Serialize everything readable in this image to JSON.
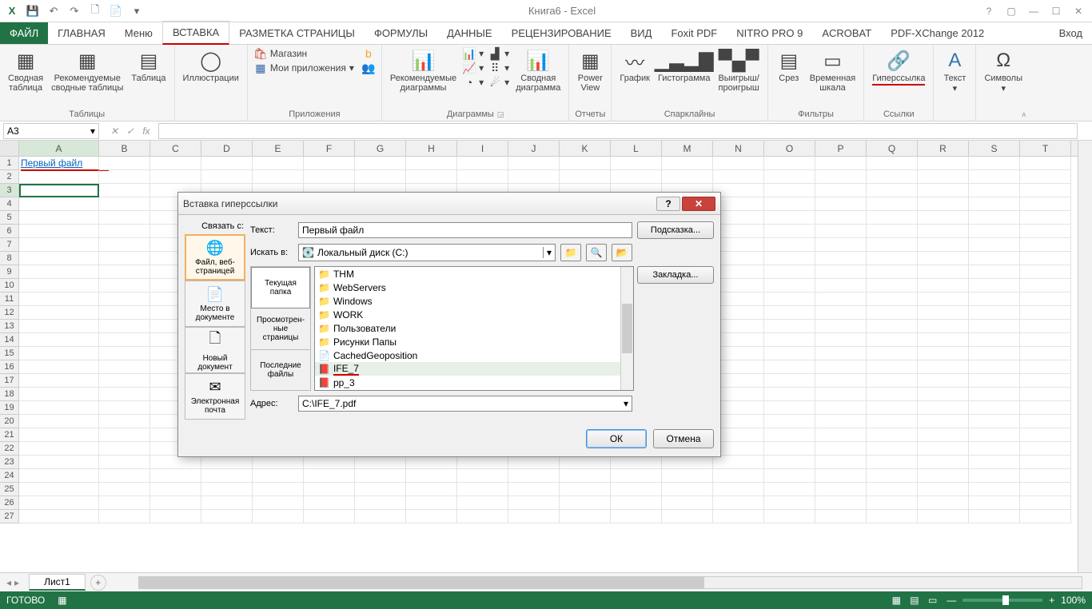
{
  "app": {
    "title": "Книга6 - Excel"
  },
  "qat": {
    "save": "💾",
    "undo": "↶",
    "redo": "↷",
    "new": "🗋",
    "open": "📄"
  },
  "tabs": {
    "file": "ФАЙЛ",
    "home": "ГЛАВНАЯ",
    "menu": "Меню",
    "insert": "ВСТАВКА",
    "pagelayout": "РАЗМЕТКА СТРАНИЦЫ",
    "formulas": "ФОРМУЛЫ",
    "data": "ДАННЫЕ",
    "review": "РЕЦЕНЗИРОВАНИЕ",
    "view": "ВИД",
    "foxit": "Foxit PDF",
    "nitro": "NITRO PRO 9",
    "acrobat": "ACROBAT",
    "pdfx": "PDF-XChange 2012",
    "login": "Вход"
  },
  "ribbon": {
    "tables": {
      "pivot": "Сводная\nтаблица",
      "recpivot": "Рекомендуемые\nсводные таблицы",
      "table": "Таблица",
      "group": "Таблицы"
    },
    "illus": {
      "label": "Иллюстрации"
    },
    "apps": {
      "store": "Магазин",
      "myapps": "Мои приложения",
      "group": "Приложения"
    },
    "charts": {
      "rec": "Рекомендуемые\nдиаграммы",
      "pivotchart": "Сводная\nдиаграмма",
      "group": "Диаграммы"
    },
    "reports": {
      "powerview": "Power\nView",
      "group": "Отчеты"
    },
    "sparks": {
      "line": "График",
      "col": "Гистограмма",
      "winloss": "Выигрыш/\nпроигрыш",
      "group": "Спарклайны"
    },
    "filters": {
      "slicer": "Срез",
      "timeline": "Временная\nшкала",
      "group": "Фильтры"
    },
    "links": {
      "hyper": "Гиперссылка",
      "group": "Ссылки"
    },
    "text": {
      "label": "Текст"
    },
    "symbols": {
      "label": "Символы"
    }
  },
  "namebox": "A3",
  "sheet": {
    "cols": [
      "A",
      "B",
      "C",
      "D",
      "E",
      "F",
      "G",
      "H",
      "I",
      "J",
      "K",
      "L",
      "M",
      "N",
      "O",
      "P",
      "Q",
      "R",
      "S",
      "T"
    ],
    "a1": "Первый файл",
    "tab": "Лист1"
  },
  "status": {
    "ready": "ГОТОВО",
    "zoom": "100%"
  },
  "dialog": {
    "title": "Вставка гиперссылки",
    "linkto_label": "Связать с:",
    "lt_file": "Файл, веб-\nстраницей",
    "lt_place": "Место в\nдокументе",
    "lt_new": "Новый\nдокумент",
    "lt_email": "Электронная\nпочта",
    "text_label": "Текст:",
    "text_value": "Первый файл",
    "tip_btn": "Подсказка...",
    "lookin_label": "Искать в:",
    "lookin_value": "Локальный диск (C:)",
    "bookmark_btn": "Закладка...",
    "bt_current": "Текущая\nпапка",
    "bt_browsed": "Просмотрен-\nные\nстраницы",
    "bt_recent": "Последние\nфайлы",
    "files": [
      {
        "name": "THM",
        "type": "folder"
      },
      {
        "name": "WebServers",
        "type": "folder"
      },
      {
        "name": "Windows",
        "type": "folder"
      },
      {
        "name": "WORK",
        "type": "folder"
      },
      {
        "name": "Пользователи",
        "type": "folder"
      },
      {
        "name": "Рисунки Папы",
        "type": "folder"
      },
      {
        "name": "CachedGeoposition",
        "type": "file"
      },
      {
        "name": "IFE_7",
        "type": "pdf",
        "selected": true,
        "red": true
      },
      {
        "name": "pp_3",
        "type": "pdf"
      }
    ],
    "addr_label": "Адрес:",
    "addr_value": "C:\\IFE_7.pdf",
    "ok": "ОК",
    "cancel": "Отмена"
  }
}
